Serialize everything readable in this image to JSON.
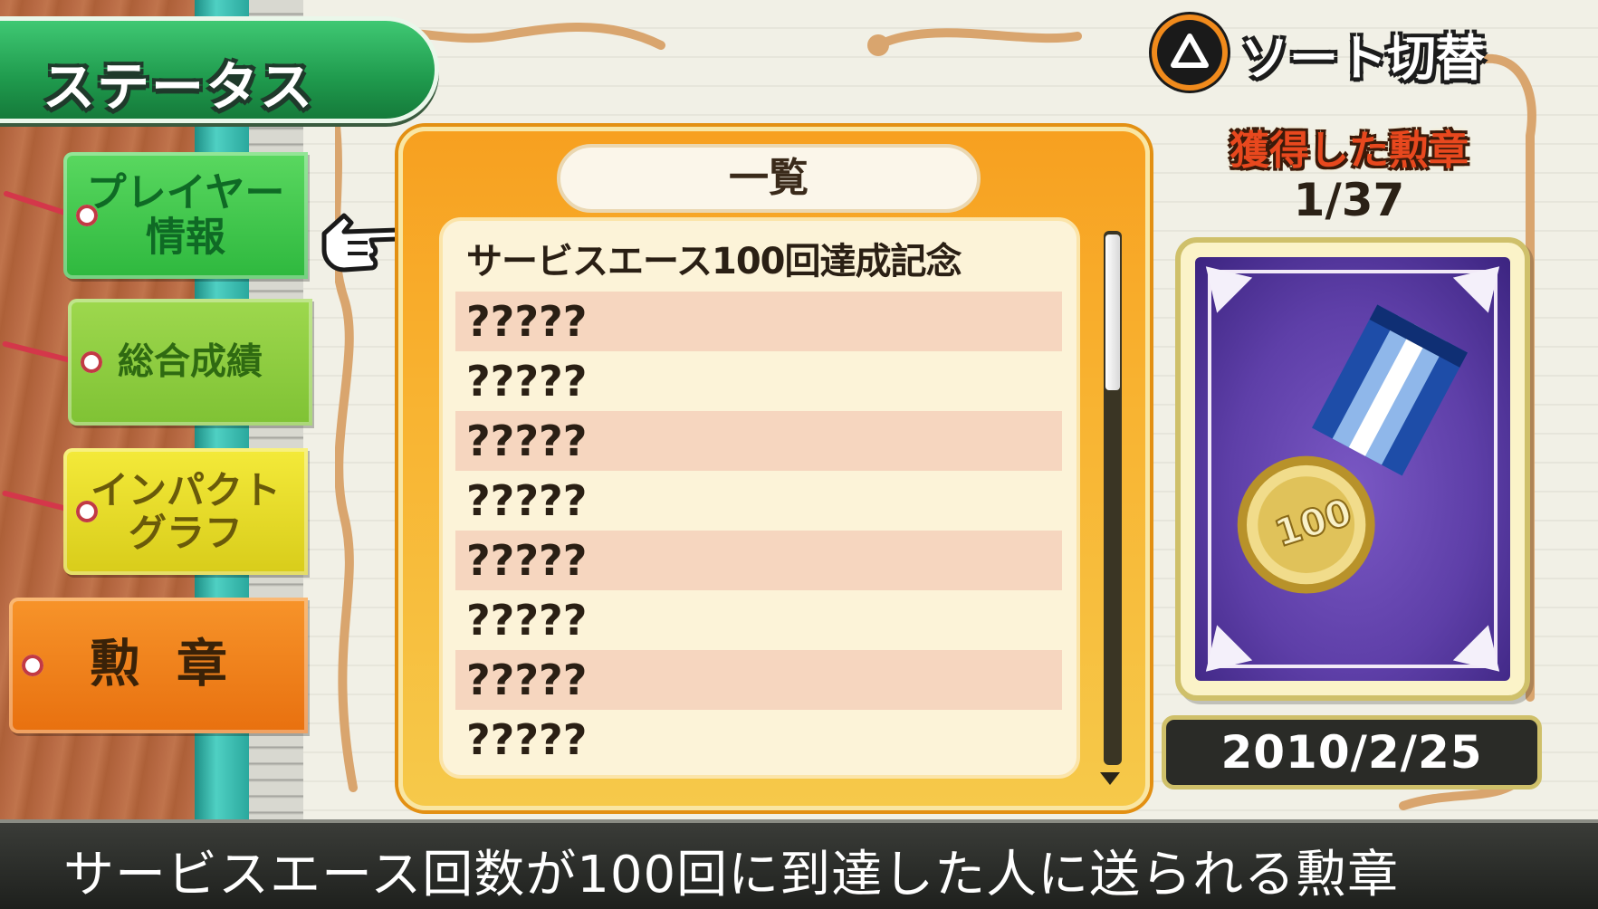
{
  "screen_title": "ステータス",
  "sort_button": {
    "icon": "triangle-button-icon",
    "label": "ソート切替"
  },
  "tabs": {
    "player_info": "プレイヤー\n情報",
    "overall": "総合成績",
    "impact_graph": "インパクト\nグラフ",
    "medals": "勲章"
  },
  "list": {
    "header": "一覧",
    "items": [
      "サービスエース100回達成記念",
      "?????",
      "?????",
      "?????",
      "?????",
      "?????",
      "?????",
      "?????",
      "?????"
    ],
    "selected_index": 0
  },
  "earned": {
    "title": "獲得した勲章",
    "count": "1/37"
  },
  "medal": {
    "icon": "service-ace-100-medal-icon",
    "coin_text": "100",
    "date": "2010/2/25"
  },
  "description": "サービスエース回数が100回に到達した人に送られる勲章",
  "colors": {
    "accent_orange": "#f7a020",
    "title_green": "#1f9a4d",
    "medal_purple": "#5e3fa8"
  }
}
